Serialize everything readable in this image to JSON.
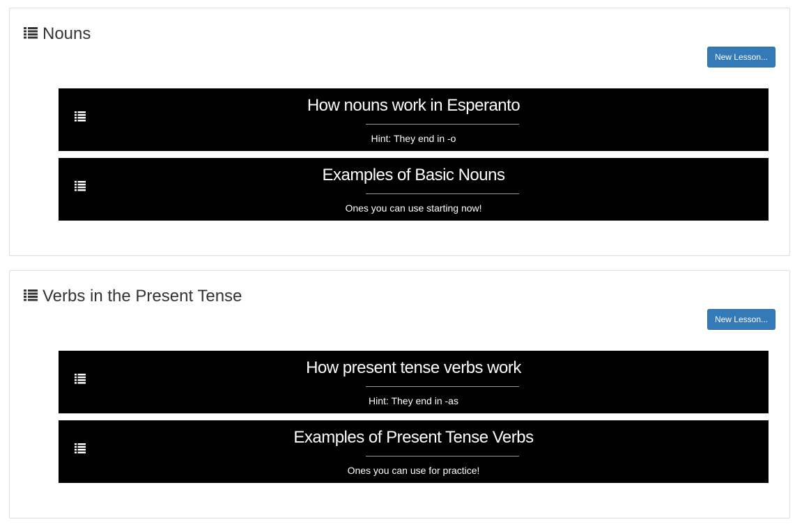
{
  "units": [
    {
      "title": "Nouns",
      "icon": "list-icon",
      "new_lesson_label": "New Lesson...",
      "lessons": [
        {
          "title": "How nouns work in Esperanto",
          "subtitle": "Hint: They end in -o",
          "icon": "list-icon"
        },
        {
          "title": "Examples of Basic Nouns",
          "subtitle": "Ones you can use starting now!",
          "icon": "list-icon"
        }
      ]
    },
    {
      "title": "Verbs in the Present Tense",
      "icon": "list-icon",
      "new_lesson_label": "New Lesson...",
      "lessons": [
        {
          "title": "How present tense verbs work",
          "subtitle": "Hint: They end in -as",
          "icon": "list-icon"
        },
        {
          "title": "Examples of Present Tense Verbs",
          "subtitle": "Ones you can use for practice!",
          "icon": "list-icon"
        }
      ]
    }
  ],
  "colors": {
    "button": "#337ab7",
    "card_background": "#000000",
    "card_text": "#ffffff",
    "heading_text": "#333333"
  }
}
